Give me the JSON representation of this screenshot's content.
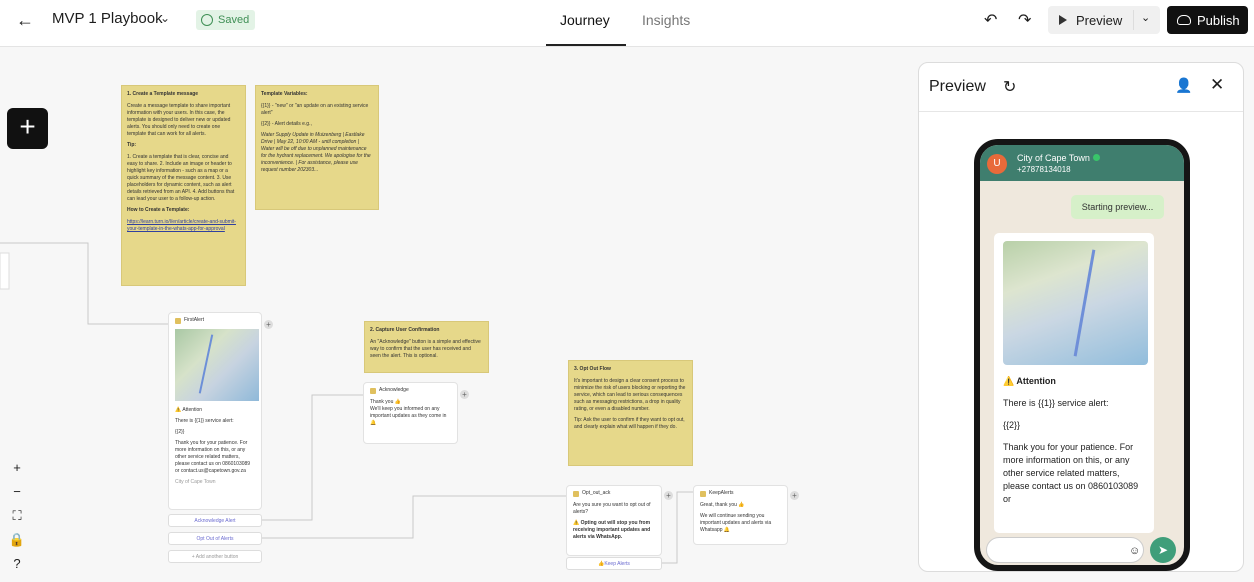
{
  "header": {
    "title": "MVP 1 Playbook",
    "saved": "Saved",
    "tabs": [
      "Journey",
      "Insights"
    ],
    "preview_label": "Preview",
    "publish_label": "Publish"
  },
  "notes": {
    "template": {
      "heading": "1. Create a Template message",
      "body": "Create a message template to share important information with your users. In this case, the template is designed to deliver new or updated alerts. You should only need to create one template that can work for all alerts.",
      "tip_heading": "Tip:",
      "tips": "1. Create a template that is clear, concise and easy to share. 2. Include an image or header to highlight key information - such as a map or a quick summary of the message content. 3. Use placeholders for dynamic content, such as alert details retrieved from an API. 4. Add buttons that can lead your user to a follow-up action.",
      "howto_heading": "How to Create a Template:",
      "howto_link": "https://learn.turn.io/l/en/article/create-and-submit-your-template-in-the-whats-app-for-approval"
    },
    "variables": {
      "heading": "Template Variables:",
      "v1": "{{1}} - \"new\" or \"an update on an existing service alert\"",
      "v2": "{{2}} - Alert details e.g.,",
      "example": "Water Supply Update in Muizenberg | Eastlake Drive | May 22, 10:00 AM - until completion | Water will be off due to unplanned maintenance for the hydrant replacement. We apologise for the inconvenience. | For assistance, please use request number 202303..."
    },
    "confirmation": {
      "heading": "2. Capture User Confirmation",
      "body": "An \"Acknowledge\" button is a simple and effective way to confirm that the user has received and seen the alert. This is optional."
    },
    "optout": {
      "heading": "3. Opt Out Flow",
      "body": "It's important to design a clear consent process to minimize the risk of users blocking or reporting the service, which can lead to serious consequences such as messaging restrictions, a drop in quality rating, or even a disabled number.",
      "tip": "Tip: Ask the user to confirm if they want to opt out, and clearly explain what will happen if they do."
    }
  },
  "nodes": {
    "first_alert": {
      "title": "FirstAlert",
      "attention": "Attention",
      "line1": "There is {{1}} service alert:",
      "line2": "{{2}}",
      "line3": "Thank you for your patience. For more information on this, or any other service related matters, please contact us on 0860103089 or contact.us@capetown.gov.za",
      "footer": "City of Cape Town",
      "buttons": [
        "Acknowledge Alert",
        "Opt Out of Alerts"
      ],
      "add_button": "+ Add another button"
    },
    "acknowledge": {
      "title": "Acknowledge",
      "line1": "Thank you 👍",
      "line2": "We'll keep you informed on any important updates as they come in 🔔"
    },
    "opt_out_ack": {
      "title": "Opt_out_ack",
      "line1": "Are you sure you want to opt out of alerts?",
      "line2": "⚠️ Opting out will stop you from receiving important updates and alerts via WhatsApp.",
      "button": "👍Keep Alerts"
    },
    "keep_alerts": {
      "title": "KeepAlerts",
      "line1": "Great, thank you 👍",
      "line2": "We will continue sending you important updates and alerts via Whatsapp 🔔"
    }
  },
  "preview": {
    "title": "Preview",
    "contact_name": "City of Cape Town",
    "contact_phone": "+27878134018",
    "avatar": "U",
    "starting": "Starting preview...",
    "attention": "⚠️ Attention",
    "line1": "There is {{1}} service alert:",
    "line2": "{{2}}",
    "line3": "Thank you for your patience. For more information on this, or any other service related matters, please contact us on 0860103089 or"
  },
  "icons": {
    "back": "arrow-left-icon",
    "chevron": "chevron-down-icon",
    "undo": "undo-icon",
    "redo": "redo-icon",
    "play": "play-icon",
    "cloud": "cloud-upload-icon",
    "add": "plus-icon",
    "refresh": "refresh-icon",
    "user": "user-icon",
    "close": "close-icon",
    "send": "send-icon",
    "emoji": "emoji-icon"
  },
  "colors": {
    "note": "#e6d88a",
    "saved": "#3f8f55",
    "wa_header": "#3f7e6e",
    "send": "#3f9e7a"
  }
}
